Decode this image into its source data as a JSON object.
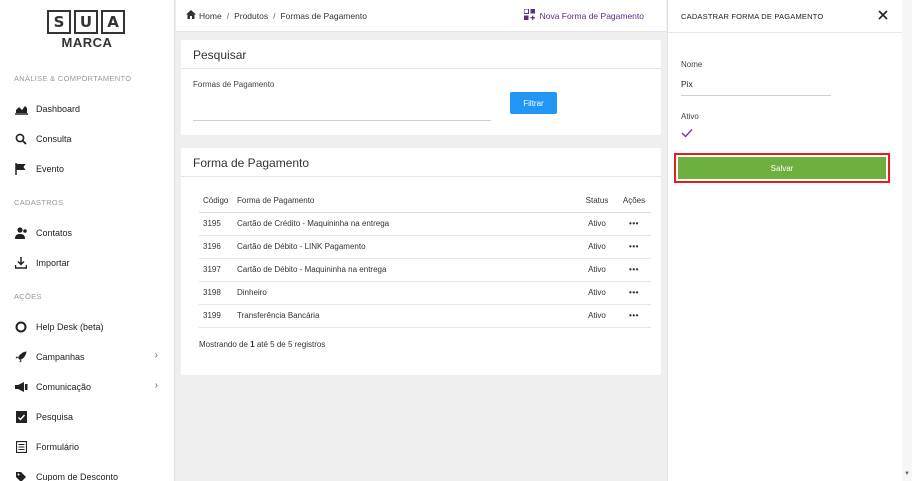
{
  "logo": {
    "letters": [
      "S",
      "U",
      "A"
    ],
    "text": "MARCA"
  },
  "sidebar": {
    "section_analysis": "ANÁLISE & COMPORTAMENTO",
    "section_cadastros": "CADASTROS",
    "section_acoes": "AÇÕES",
    "items": [
      {
        "label": "Dashboard",
        "icon": "chart-icon"
      },
      {
        "label": "Consulta",
        "icon": "search-icon"
      },
      {
        "label": "Evento",
        "icon": "flag-icon"
      },
      {
        "label": "Contatos",
        "icon": "users-icon"
      },
      {
        "label": "Importar",
        "icon": "download-icon"
      },
      {
        "label": "Help Desk (beta)",
        "icon": "help-icon"
      },
      {
        "label": "Campanhas",
        "icon": "rocket-icon"
      },
      {
        "label": "Comunicação",
        "icon": "megaphone-icon"
      },
      {
        "label": "Pesquisa",
        "icon": "survey-icon"
      },
      {
        "label": "Formulário",
        "icon": "form-icon"
      },
      {
        "label": "Cupom de Desconto",
        "icon": "coupon-icon"
      }
    ]
  },
  "breadcrumb": {
    "home": "Home",
    "products": "Produtos",
    "current": "Formas de Pagamento"
  },
  "header": {
    "new_label": "Nova Forma de Pagamento"
  },
  "search": {
    "title": "Pesquisar",
    "field_label": "Formas de Pagamento",
    "field_value": "",
    "filter_label": "Filtrar"
  },
  "list": {
    "title": "Forma de Pagamento",
    "columns": {
      "code": "Código",
      "name": "Forma de Pagamento",
      "status": "Status",
      "actions": "Ações"
    },
    "rows": [
      {
        "code": "3195",
        "name": "Cartão de Crédito - Maquininha na entrega",
        "status": "Ativo",
        "actions": "•••"
      },
      {
        "code": "3196",
        "name": "Cartão de Débito - LINK Pagamento",
        "status": "Ativo",
        "actions": "•••"
      },
      {
        "code": "3197",
        "name": "Cartão de Débito - Maquininha na entrega",
        "status": "Ativo",
        "actions": "•••"
      },
      {
        "code": "3198",
        "name": "Dinheiro",
        "status": "Ativo",
        "actions": "•••"
      },
      {
        "code": "3199",
        "name": "Transferência Bancária",
        "status": "Ativo",
        "actions": "•••"
      }
    ],
    "footer": {
      "prefix": "Mostrando de ",
      "from": "1",
      "middle": " até 5 de 5 registros"
    }
  },
  "panel": {
    "title": "CADASTRAR FORMA DE PAGAMENTO",
    "name_label": "Nome",
    "name_value": "Pix",
    "active_label": "Ativo",
    "active_checked": true,
    "save_label": "Salvar"
  },
  "colors": {
    "accent": "#5b2d8a",
    "primary": "#2196f3",
    "save": "#6eb040",
    "highlight": "#e02020"
  }
}
